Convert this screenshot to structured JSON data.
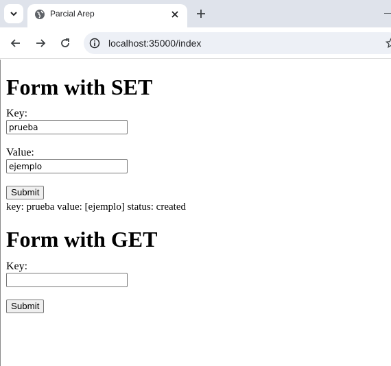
{
  "browser": {
    "tab_title": "Parcial Arep",
    "url": "localhost:35000/index"
  },
  "set_form": {
    "heading": "Form with SET",
    "key_label": "Key:",
    "key_value": "prueba",
    "value_label": "Value:",
    "value_value": "ejemplo",
    "submit_label": "Submit",
    "result_text": "key: prueba value: [ejemplo] status: created"
  },
  "get_form": {
    "heading": "Form with GET",
    "key_label": "Key:",
    "key_value": "",
    "submit_label": "Submit"
  }
}
